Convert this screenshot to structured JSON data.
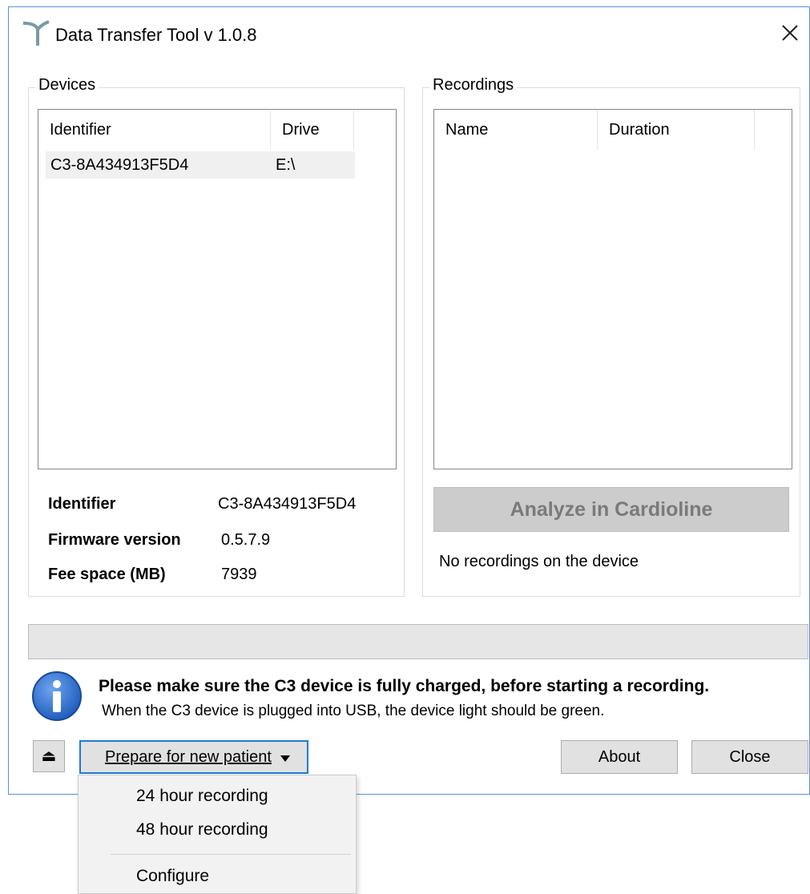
{
  "window": {
    "title": "Data Transfer Tool v 1.0.8"
  },
  "devices": {
    "group_label": "Devices",
    "columns": [
      "Identifier",
      "Drive"
    ],
    "rows": [
      {
        "identifier": "C3-8A434913F5D4",
        "drive": "E:\\"
      }
    ]
  },
  "recordings": {
    "group_label": "Recordings",
    "columns": [
      "Name",
      "Duration"
    ],
    "analyze_label": "Analyze in Cardioline",
    "status": "No recordings on the device"
  },
  "device_info": {
    "identifier_label": "Identifier",
    "identifier_value": "C3-8A434913F5D4",
    "firmware_label": "Firmware version",
    "firmware_value": "0.5.7.9",
    "space_label": "Fee space (MB)",
    "space_value": "7939"
  },
  "notice": {
    "bold": "Please make sure the C3 device is fully charged, before starting a recording.",
    "sub": "When the C3 device is plugged into USB, the device light should be green."
  },
  "buttons": {
    "eject_glyph": "⏏",
    "prepare": "Prepare for new patient",
    "about": "About",
    "close": "Close"
  },
  "menu": {
    "items": [
      "24 hour recording",
      "48 hour recording",
      "Configure"
    ]
  },
  "colors": {
    "accent": "#1c7bd8",
    "window_border": "#5b8fd6",
    "info_icon": "#1f5fbf"
  }
}
